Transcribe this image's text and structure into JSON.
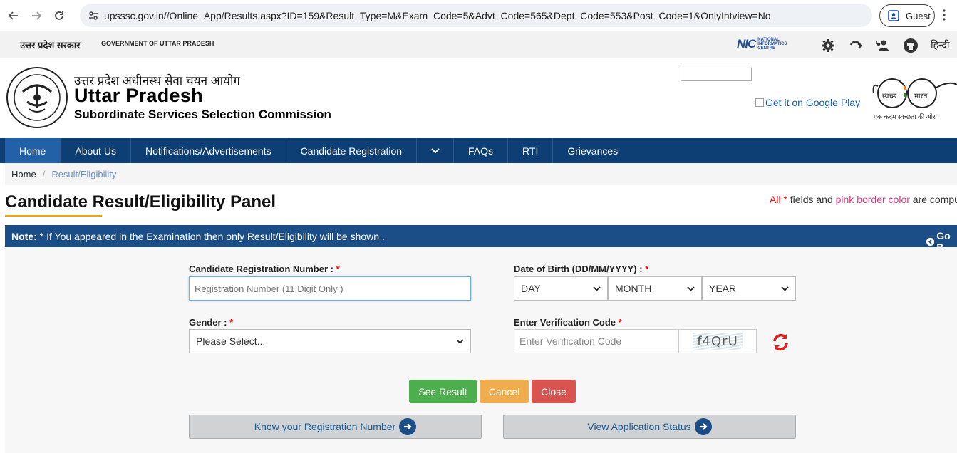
{
  "browser": {
    "url": "upsssc.gov.in//Online_App/Results.aspx?ID=159&Result_Type=M&Exam_Code=5&Advt_Code=565&Dept_Code=553&Post_Code=1&OnlyIntview=No",
    "profile_label": "Guest"
  },
  "gov_strip": {
    "hindi": "उत्तर प्रदेश सरकार",
    "english": "GOVERNMENT OF UTTAR PRADESH",
    "nic_logo": "NIC",
    "nic_text": "NATIONAL INFORMATICS CENTRE",
    "language_link": "हिन्दी"
  },
  "header": {
    "hindi_name": "उत्तर प्रदेश अधीनस्थ सेवा चयन आयोग",
    "title": "Uttar Pradesh",
    "subtitle": "Subordinate Services Selection Commission",
    "google_play": "Get it on Google Play",
    "swachh_left": "स्वच्छ",
    "swachh_right": "भारत",
    "swachh_tag": "एक कदम स्वच्छता की ओर"
  },
  "nav": {
    "items": [
      "Home",
      "About Us",
      "Notifications/Advertisements",
      "Candidate Registration",
      "FAQs",
      "RTI",
      "Grievances"
    ]
  },
  "breadcrumb": {
    "home": "Home",
    "current": "Result/Eligibility"
  },
  "page": {
    "title": "Candidate Result/Eligibility Panel",
    "req_part1": "All",
    "req_star": "*",
    "req_part2": "fields and",
    "req_pink": "pink border color",
    "req_part3": "are compu"
  },
  "note": {
    "label": "Note:",
    "text": "* If You appeared in the Examination then only Result/Eligibility will be shown .",
    "go_back": "Go B"
  },
  "form": {
    "reg_label": "Candidate Registration Number :",
    "reg_placeholder": "Registration Number (11 Digit Only )",
    "dob_label": "Date of Birth (DD/MM/YYYY) :",
    "day": "DAY",
    "month": "MONTH",
    "year": "YEAR",
    "gender_label": "Gender :",
    "gender_value": "Please Select...",
    "verif_label": "Enter Verification Code",
    "verif_placeholder": "Enter Verification Code",
    "captcha_text": "f4QrU",
    "star": "*"
  },
  "buttons": {
    "see_result": "See Result",
    "cancel": "Cancel",
    "close": "Close",
    "know_reg": "Know your Registration Number",
    "view_status": "View Application Status"
  },
  "colors": {
    "navbar": "#0d3e74",
    "note_bar": "#1b4d86",
    "see_result": "#4cae4c",
    "cancel": "#f0ad4e",
    "close": "#d9534f"
  }
}
